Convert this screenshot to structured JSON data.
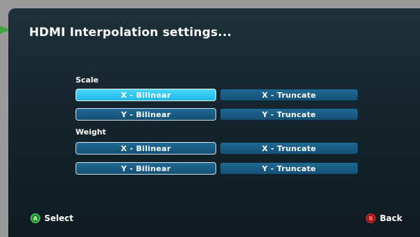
{
  "title": "HDMI Interpolation settings...",
  "sections": {
    "scale": {
      "label": "Scale",
      "x_bilinear": "X - Bilinear",
      "x_truncate": "X - Truncate",
      "y_bilinear": "Y - Bilinear",
      "y_truncate": "Y - Truncate"
    },
    "weight": {
      "label": "Weight",
      "x_bilinear": "X - Bilinear",
      "x_truncate": "X - Truncate",
      "y_bilinear": "Y - Bilinear",
      "y_truncate": "Y - Truncate"
    }
  },
  "footer": {
    "select_glyph": "A",
    "select_label": "Select",
    "back_glyph": "B",
    "back_label": "Back"
  },
  "colors": {
    "focused": "#1fb7ea",
    "option": "#154f73",
    "a_button": "#1a8f2c",
    "b_button": "#a01818"
  }
}
